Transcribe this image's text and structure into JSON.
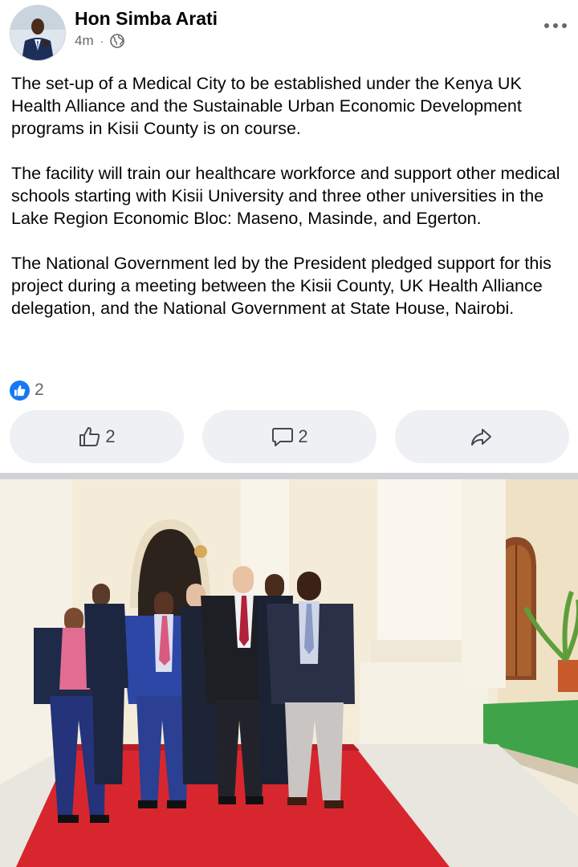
{
  "post": {
    "author": "Hon Simba Arati",
    "time": "4m",
    "separator": "·",
    "privacy_icon": "globe-icon",
    "paragraphs": [
      "The set-up of a Medical City to be established under the Kenya UK Health Alliance and the Sustainable Urban Economic Development programs in Kisii County is on course.",
      "The facility will train our healthcare workforce and support other medical schools starting with Kisii University and three other universities in the Lake Region Economic Bloc: Maseno, Masinde, and Egerton.",
      "The National Government led by the President pledged support for this project during a meeting between the Kisii County, UK Health Alliance delegation, and the National Government at State House, Nairobi."
    ],
    "reaction_count": "2"
  },
  "actions": {
    "like_count": "2",
    "comment_count": "2"
  },
  "icons": {
    "like": "thumbs-up-icon",
    "comment": "comment-bubble-icon",
    "share": "share-arrow-icon",
    "more": "more-dots-icon"
  },
  "colors": {
    "accent": "#1877f2",
    "button_bg": "#eef0f3",
    "secondary_text": "#65676b",
    "carpet": "#d8262e",
    "lawn": "#3fa34a"
  }
}
